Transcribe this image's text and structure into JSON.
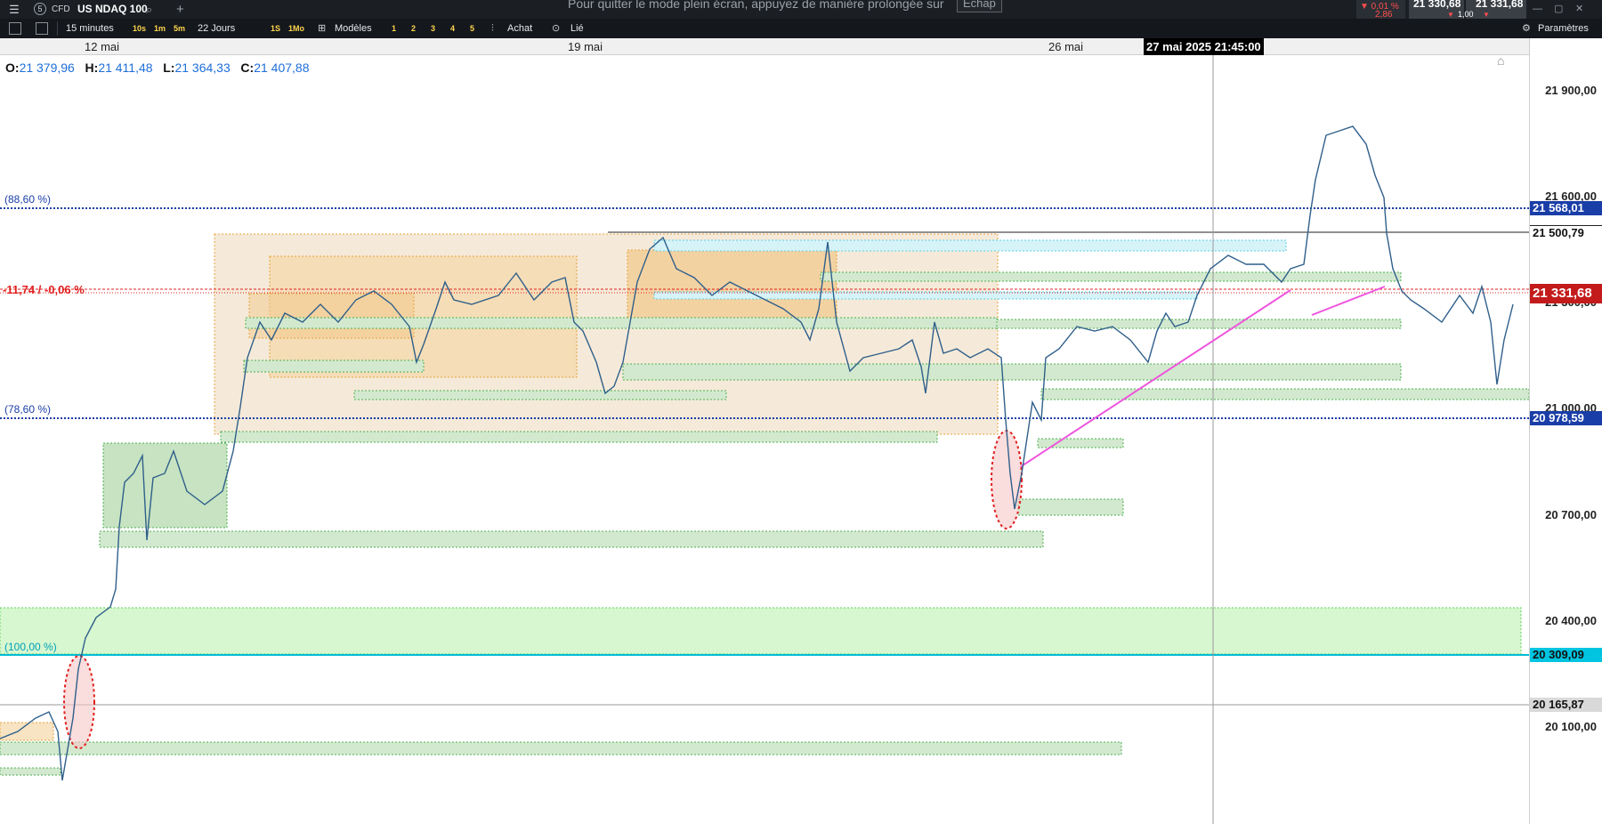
{
  "topbar": {
    "menu_icon": "menu-icon",
    "instrument_number": "5",
    "instrument_type": "CFD",
    "instrument_name": "US NDAQ 100",
    "add_tab": "+",
    "fullscreen_notice": "Pour quitter le mode plein écran, appuyez de manière prolongée sur",
    "escape_key": "Échap",
    "change_pct": "▼ 0,01 %",
    "change_abs": "2,86",
    "bid_price": "21 330,68",
    "ask_price": "21 331,68",
    "lot": "1,00",
    "window_controls": [
      "—",
      "▢",
      "✕"
    ]
  },
  "toolbar": {
    "interval_label": "15 minutes",
    "quick_intervals": [
      "10s",
      "1m",
      "5m"
    ],
    "range_label": "22 Jours",
    "range_quick": [
      "1S",
      "1Mo"
    ],
    "templates_label": "Modèles",
    "layout_numbers": [
      "1",
      "2",
      "3",
      "4",
      "5"
    ],
    "trade_label": "Achat",
    "link_label": "Lié",
    "settings_label": "Paramètres"
  },
  "timeaxis": {
    "labels": [
      "12 mai",
      "19 mai",
      "26 mai"
    ],
    "cursor_time": "27 mai 2025 21:45:00"
  },
  "ohlc": {
    "o_label": "O:",
    "o_value": "21 379,96",
    "h_label": "H:",
    "h_value": "21 411,48",
    "l_label": "L:",
    "l_value": "21 364,33",
    "c_label": "C:",
    "c_value": "21 407,88"
  },
  "fib_labels": {
    "f886": "(88,60 %)",
    "f786": "(78,60 %)",
    "f100": "(100,00 %)",
    "pnl": "-11,74 / -0,06 %"
  },
  "price_axis": {
    "ticks": [
      "21 900,00",
      "21 600,00",
      "21 300,00",
      "21 000,00",
      "20 700,00",
      "20 400,00",
      "20 100,00"
    ],
    "tag_fib886": "21 568,01",
    "tag_line": "21 500,79",
    "tag_current": "21 331,68",
    "tag_fib786": "20 978,59",
    "tag_fib100": "20 309,09",
    "tag_cursor": "20 165,87"
  },
  "colors": {
    "candle": "#2f5f8a",
    "fib_line": "#1a3ea8",
    "current_line": "#e02020",
    "fib100_line": "#00bcd4",
    "zone_green": "#d3e9cf",
    "zone_orange": "#f7d9a8",
    "zone_cyan": "#d6f3f8",
    "trend_magenta": "#ee55dd"
  }
}
